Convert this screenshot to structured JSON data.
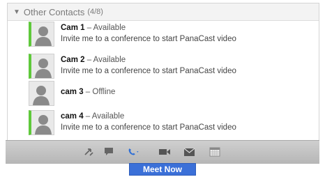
{
  "group": {
    "title": "Other Contacts",
    "count": "(4/8)"
  },
  "contacts": [
    {
      "name": "Cam 1",
      "status": " – Available",
      "message": "Invite me to a conference to start PanaCast video"
    },
    {
      "name": "Cam 2",
      "status": " – Available",
      "message": "Invite me to a conference to start PanaCast video"
    },
    {
      "name": "cam 3",
      "status": " – Offline",
      "message": ""
    },
    {
      "name": "cam 4",
      "status": " – Available",
      "message": "Invite me to a conference to start PanaCast video"
    }
  ],
  "toolbar": {
    "icons": [
      "transfer-icon",
      "chat-icon",
      "phone-icon",
      "video-icon",
      "mail-icon",
      "calendar-icon"
    ],
    "popup_label": "Meet Now"
  },
  "colors": {
    "available": "#5fc93b",
    "popup": "#3b70d8",
    "phone": "#2f6fd6"
  }
}
